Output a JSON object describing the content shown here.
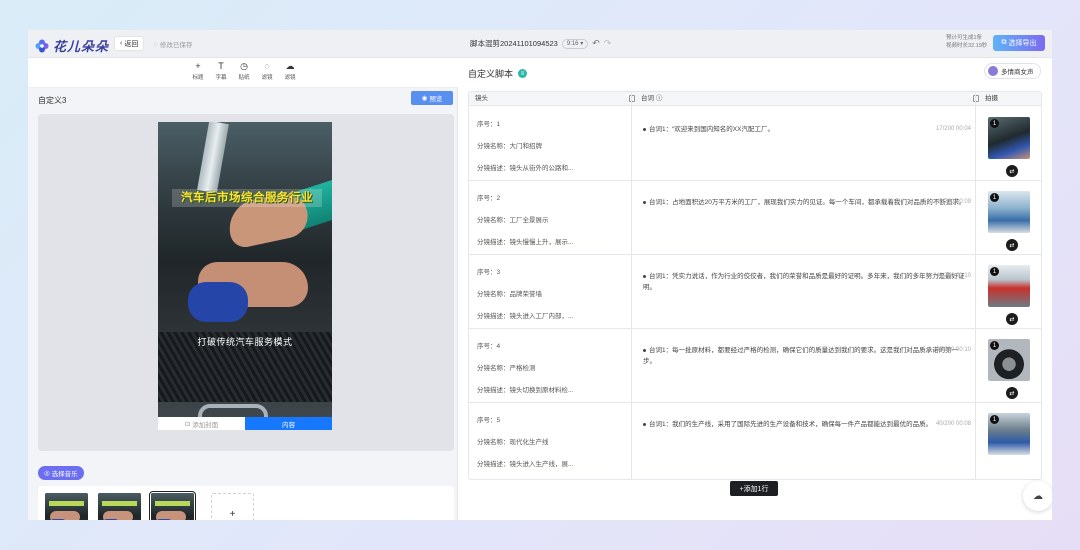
{
  "app": {
    "brand": "花儿朵朵"
  },
  "header": {
    "back_label": "返回",
    "saved_text": "修改已保存",
    "file_name": "脚本混剪20241101094523",
    "ratio": "9:16",
    "quota_line1": "预计可生成1条",
    "quota_line2": "视频时长32.19秒",
    "export_label": "选择导出"
  },
  "toolbar": {
    "tools": [
      {
        "icon": "plus-icon",
        "glyph": "+",
        "label": "标题"
      },
      {
        "icon": "text-icon",
        "glyph": "T",
        "label": "字幕"
      },
      {
        "icon": "sticker-icon",
        "glyph": "◷",
        "label": "贴纸"
      },
      {
        "icon": "chat-icon",
        "glyph": "◌",
        "label": "滤镜"
      },
      {
        "icon": "cloud-icon",
        "glyph": "☁",
        "label": "滤镜"
      }
    ]
  },
  "editor": {
    "scene_title": "自定义3",
    "preview_label": "预览",
    "video_title_caption": "汽车后市场综合服务行业",
    "video_sub_caption": "打破传统汽车服务模式",
    "tab_add_cover": "添加封面",
    "tab_content": "内容",
    "music_label": "选择音乐",
    "add_clip": "+"
  },
  "script": {
    "title": "自定义脚本",
    "voice_label": "多情商女声",
    "columns": {
      "shot": "镜头",
      "line": "台词",
      "media": "拍摄"
    },
    "rows": [
      {
        "seq": "序号：1",
        "name": "分镜名称：大门和招牌",
        "desc": "分镜描述：镜头从街外的公路和...",
        "line": "台词1：“欢迎来到国内知名的XX汽配工厂。",
        "count": "17/200",
        "time": "00:04",
        "media_num": "1"
      },
      {
        "seq": "序号：2",
        "name": "分镜名称：工厂全景展示",
        "desc": "分镜描述：镜头慢慢上升，展示...",
        "line": "台词1：占地面积达20万平方米的工厂，展现我们实力的见证。每一个车间，都承载着我们对品质的不断追求。",
        "count": "45/200",
        "time": "00:09",
        "media_num": "1"
      },
      {
        "seq": "序号：3",
        "name": "分镜名称：品牌荣誉墙",
        "desc": "分镜描述：镜头进入工厂内部，...",
        "line": "台词1：凭实力说话，作为行业的佼佼者，我们的荣誉和品质是最好的证明。多年来，我们的多年努力是最好证明。",
        "count": "46/200",
        "time": "00:10",
        "media_num": "1"
      },
      {
        "seq": "序号：4",
        "name": "分镜名称：严格检测",
        "desc": "分镜描述：镜头切换到原材料检...",
        "line": "台词1：每一批原材料，都要经过严格的检测，确保它们的质量达到我们的要求。这是我们对品质承诺的第一步。",
        "count": "46/200",
        "time": "00:10",
        "media_num": "1"
      },
      {
        "seq": "序号：5",
        "name": "分镜名称：现代化生产线",
        "desc": "分镜描述：镜头进入生产线，展...",
        "line": "台词1：我们的生产线，采用了国际先进的生产设备和技术，确保每一件产品都能达到最优的品质。",
        "count": "40/200",
        "time": "00:08",
        "media_num": "1"
      }
    ],
    "add_row_label": "+添加1行"
  }
}
